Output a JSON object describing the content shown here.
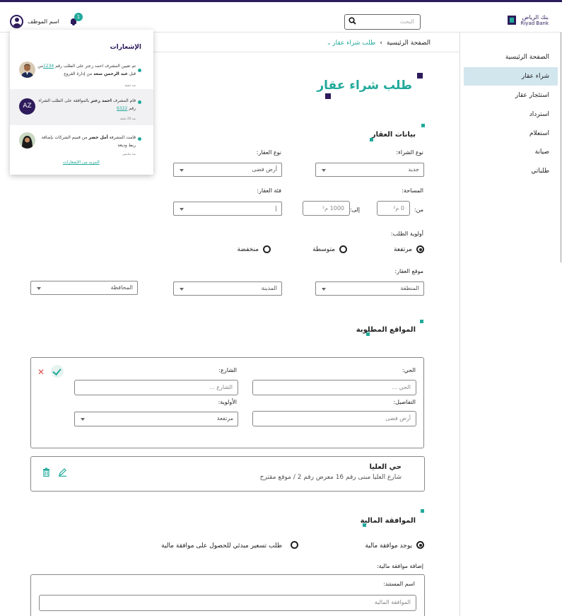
{
  "header": {
    "logo_ar": "بنك الرياض",
    "logo_en": "Riyad Bank",
    "search_placeholder": "البحث",
    "user_name": "اسم الموظف",
    "notification_count": "1"
  },
  "sidebar": {
    "items": [
      {
        "label": "الصفحة الرئيسية",
        "active": false
      },
      {
        "label": "شراء عقار",
        "active": true
      },
      {
        "label": "استئجار عقار",
        "active": false
      },
      {
        "label": "استرداد",
        "active": false
      },
      {
        "label": "استعلام",
        "active": false
      },
      {
        "label": "صيانة",
        "active": false
      },
      {
        "label": "طلباتي",
        "active": false
      }
    ]
  },
  "breadcrumb": {
    "home": "الصفحة الرئيسية",
    "current": "طلب شراء عقار"
  },
  "page_title": "طلب شراء عقار",
  "property": {
    "section_title": "بيانات العقار",
    "purchase_type_label": "نوع الشراء:",
    "purchase_type_value": "جديد",
    "property_type_label": "نوع العقار:",
    "property_type_value": "أرض فضى",
    "area_label": "المساحة:",
    "from_label": "من:",
    "from_value": "0 م²",
    "to_label": "إلى:",
    "to_value": "1000 م²",
    "category_label": "فئة العقار:",
    "category_value": "|",
    "priority_label": "أولوية الطلب:",
    "priority_options": [
      "مرتفعة",
      "متوسطة",
      "منخفضة"
    ],
    "priority_selected": "مرتفعة",
    "location_label": "موقع العقار:",
    "region_value": "المنطقة",
    "city_value": "المدينة",
    "province_value": "المحافظة"
  },
  "locations": {
    "section_title": "المواقع المطلوبة",
    "district_label": "الحي:",
    "district_placeholder": "الحي ...",
    "street_label": "الشارع:",
    "street_placeholder": "الشارع ...",
    "details_label": "التفاصيل:",
    "details_value": "أرض فضى",
    "priority_label": "الأولوية:",
    "priority_value": "مرتفعة",
    "saved": {
      "title": "حي العليا",
      "desc": "شارع العليا مبنى رقم 16 معرض رقم 2 / موقع مقترح"
    }
  },
  "finance": {
    "section_title": "الموافقة المالية",
    "option_yes": "يوجد موافقة مالية",
    "option_request": "طلب تسعير مبدئي للحصول على موافقة مالية",
    "selected": "يوجد موافقة مالية",
    "add_label": "إضافة موافقة مالية:",
    "doc_name_label": "اسم المستند:",
    "doc_name_value": "الموافقة المالية"
  },
  "notifications": {
    "title": "الإشعارات",
    "items": [
      {
        "text_pre": "تم تعيين المشرف احمد زعتر على الطلب رقم",
        "number": "1234",
        "text_mid": "من قبل",
        "actor": "عبد الرحمن سعد",
        "text_post": "من إدارة الفروع",
        "time": "منذ دقيقة"
      },
      {
        "avatar": "AZ",
        "text_pre": "قام المشرف",
        "actor": "احمد زعتر",
        "text_mid": "بالموافقة على الطلب",
        "text_post": "الشراء رقم",
        "number": "6322",
        "time": "منذ 20 دقيقة"
      },
      {
        "text_pre": "قامت المشرفة",
        "actor": "أمل خضر",
        "text_mid": "من قسم الشركات بإضافة",
        "text_post": "ربط وديعة",
        "time": "منذ ساعتين"
      }
    ],
    "more_link": "المزيد من الإشعارات"
  },
  "colors": {
    "primary_navy": "#2d1b5c",
    "accent_teal": "#21a99a",
    "active_bg": "#d2e6ee",
    "delete_red": "#e05050"
  }
}
